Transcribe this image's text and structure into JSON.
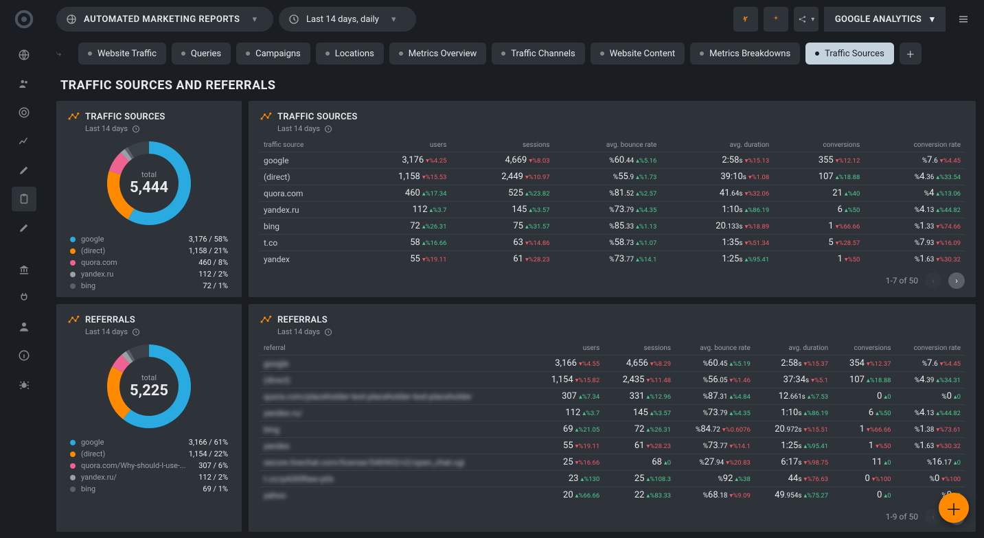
{
  "header": {
    "report_name": "AUTOMATED MARKETING REPORTS",
    "date_range": "Last 14 days, daily",
    "profile": "GOOGLE ANALYTICS"
  },
  "tabs": [
    {
      "label": "Website Traffic",
      "active": false
    },
    {
      "label": "Queries",
      "active": false
    },
    {
      "label": "Campaigns",
      "active": false
    },
    {
      "label": "Locations",
      "active": false
    },
    {
      "label": "Metrics Overview",
      "active": false
    },
    {
      "label": "Traffic Channels",
      "active": false
    },
    {
      "label": "Website Content",
      "active": false
    },
    {
      "label": "Metrics Breakdowns",
      "active": false
    },
    {
      "label": "Traffic Sources",
      "active": true
    }
  ],
  "page_title": "TRAFFIC SOURCES AND REFERRALS",
  "subtitle": "Last 14 days",
  "colors": [
    "#29abe2",
    "#ff8a00",
    "#f06292",
    "#9aa0a6",
    "#5a6068",
    "#4ec88a",
    "#ffd54f"
  ],
  "chart_data": [
    {
      "id": "traffic_sources_donut",
      "type": "pie",
      "title": "TRAFFIC SOURCES",
      "total_label": "total",
      "total": "5,444",
      "categories": [
        "google",
        "(direct)",
        "quora.com",
        "yandex.ru",
        "bing"
      ],
      "values": [
        3176,
        1158,
        460,
        112,
        72
      ],
      "pct": [
        58,
        21,
        8,
        2,
        1
      ],
      "display_values": [
        "3,176",
        "1,158",
        "460",
        "112",
        "72"
      ]
    },
    {
      "id": "referrals_donut",
      "type": "pie",
      "title": "REFERRALS",
      "total_label": "total",
      "total": "5,225",
      "categories": [
        "google",
        "(direct)",
        "quora.com/Why-should-I-use-...",
        "yandex.ru/",
        "bing"
      ],
      "values": [
        3166,
        1154,
        307,
        112,
        69
      ],
      "pct": [
        61,
        22,
        6,
        2,
        1
      ],
      "display_values": [
        "3,166",
        "1,154",
        "307",
        "112",
        "69"
      ]
    }
  ],
  "tables": {
    "traffic": {
      "title": "TRAFFIC SOURCES",
      "head_label": "traffic source",
      "columns": [
        "users",
        "sessions",
        "avg. bounce rate",
        "avg. duration",
        "conversions",
        "conversion rate"
      ],
      "pager": "1-7 of 50",
      "rows": [
        {
          "src": "google",
          "cells": [
            {
              "v": "3,176",
              "d": "%4.25",
              "dir": "down"
            },
            {
              "v": "4,669",
              "d": "%8.03",
              "dir": "down"
            },
            {
              "v": "60",
              "suf": ".44",
              "pre": "%",
              "d": "%5.16",
              "dir": "up"
            },
            {
              "v": "2:58",
              "suf": "s",
              "d": "%15.13",
              "dir": "down"
            },
            {
              "v": "355",
              "d": "%12.12",
              "dir": "down"
            },
            {
              "v": "7",
              "suf": ".6",
              "pre": "%",
              "d": "%4.45",
              "dir": "down"
            }
          ]
        },
        {
          "src": "(direct)",
          "cells": [
            {
              "v": "1,158",
              "d": "%15.53",
              "dir": "down"
            },
            {
              "v": "2,449",
              "d": "%10.97",
              "dir": "down"
            },
            {
              "v": "55",
              "suf": ".9",
              "pre": "%",
              "d": "%1.73",
              "dir": "up"
            },
            {
              "v": "39:10",
              "suf": "s",
              "d": "%1.08",
              "dir": "down"
            },
            {
              "v": "107",
              "d": "%18.88",
              "dir": "up"
            },
            {
              "v": "4",
              "suf": ".36",
              "pre": "%",
              "d": "%33.54",
              "dir": "up"
            }
          ]
        },
        {
          "src": "quora.com",
          "cells": [
            {
              "v": "460",
              "d": "%17.34",
              "dir": "up"
            },
            {
              "v": "525",
              "d": "%23.82",
              "dir": "up"
            },
            {
              "v": "81",
              "suf": ".52",
              "pre": "%",
              "d": "%2.57",
              "dir": "up"
            },
            {
              "v": "41",
              "suf": ".64s",
              "d": "%32.06",
              "dir": "down"
            },
            {
              "v": "21",
              "d": "%40",
              "dir": "up"
            },
            {
              "v": "4",
              "pre": "%",
              "d": "%13.06",
              "dir": "up"
            }
          ]
        },
        {
          "src": "yandex.ru",
          "cells": [
            {
              "v": "112",
              "d": "%3.7",
              "dir": "up"
            },
            {
              "v": "145",
              "d": "%3.57",
              "dir": "up"
            },
            {
              "v": "73",
              "suf": ".79",
              "pre": "%",
              "d": "%4.35",
              "dir": "up"
            },
            {
              "v": "1:10",
              "suf": "s",
              "d": "%86.19",
              "dir": "up"
            },
            {
              "v": "6",
              "d": "%50",
              "dir": "up"
            },
            {
              "v": "4",
              "suf": ".13",
              "pre": "%",
              "d": "%44.82",
              "dir": "up"
            }
          ]
        },
        {
          "src": "bing",
          "cells": [
            {
              "v": "72",
              "d": "%26.31",
              "dir": "up"
            },
            {
              "v": "75",
              "d": "%31.57",
              "dir": "up"
            },
            {
              "v": "85",
              "suf": ".33",
              "pre": "%",
              "d": "%1.13",
              "dir": "up"
            },
            {
              "v": "20",
              "suf": ".133s",
              "d": "%18.89",
              "dir": "down"
            },
            {
              "v": "1",
              "d": "%66.66",
              "dir": "down"
            },
            {
              "v": "1",
              "suf": ".33",
              "pre": "%",
              "d": "%74.66",
              "dir": "down"
            }
          ]
        },
        {
          "src": "t.co",
          "cells": [
            {
              "v": "58",
              "d": "%16.66",
              "dir": "up"
            },
            {
              "v": "63",
              "d": "%14.86",
              "dir": "down"
            },
            {
              "v": "58",
              "suf": ".73",
              "pre": "%",
              "d": "%1.07",
              "dir": "up"
            },
            {
              "v": "1:35",
              "suf": "s",
              "d": "%51.34",
              "dir": "down"
            },
            {
              "v": "5",
              "d": "%28.57",
              "dir": "down"
            },
            {
              "v": "7",
              "suf": ".93",
              "pre": "%",
              "d": "%16.09",
              "dir": "down"
            }
          ]
        },
        {
          "src": "yandex",
          "cells": [
            {
              "v": "55",
              "d": "%19.11",
              "dir": "down"
            },
            {
              "v": "61",
              "d": "%28.23",
              "dir": "down"
            },
            {
              "v": "73",
              "suf": ".77",
              "pre": "%",
              "d": "%14.1",
              "dir": "up"
            },
            {
              "v": "1:25",
              "suf": "s",
              "d": "%95.41",
              "dir": "up"
            },
            {
              "v": "1",
              "d": "%50",
              "dir": "down"
            },
            {
              "v": "1",
              "suf": ".63",
              "pre": "%",
              "d": "%30.32",
              "dir": "down"
            }
          ]
        }
      ]
    },
    "referrals": {
      "title": "REFERRALS",
      "head_label": "referral",
      "columns": [
        "users",
        "sessions",
        "avg. bounce rate",
        "avg. duration",
        "conversions",
        "conversion rate"
      ],
      "pager": "1-9 of 50",
      "rows": [
        {
          "src": "google",
          "blur": true,
          "cells": [
            {
              "v": "3,166",
              "d": "%4.55",
              "dir": "down"
            },
            {
              "v": "4,656",
              "d": "%8.29",
              "dir": "down"
            },
            {
              "v": "60",
              "suf": ".45",
              "pre": "%",
              "d": "%5.19",
              "dir": "up"
            },
            {
              "v": "2:58",
              "suf": "s",
              "d": "%15.37",
              "dir": "down"
            },
            {
              "v": "354",
              "d": "%12.37",
              "dir": "down"
            },
            {
              "v": "7",
              "suf": ".6",
              "pre": "%",
              "d": "%4.45",
              "dir": "down"
            }
          ]
        },
        {
          "src": "(direct)",
          "blur": true,
          "cells": [
            {
              "v": "1,154",
              "d": "%15.82",
              "dir": "down"
            },
            {
              "v": "2,435",
              "d": "%11.48",
              "dir": "down"
            },
            {
              "v": "56",
              "suf": ".05",
              "pre": "%",
              "d": "%1.46",
              "dir": "down"
            },
            {
              "v": "37:34",
              "suf": "s",
              "d": "%5.1",
              "dir": "down"
            },
            {
              "v": "107",
              "d": "%18.88",
              "dir": "up"
            },
            {
              "v": "4",
              "suf": ".39",
              "pre": "%",
              "d": "%34.31",
              "dir": "up"
            }
          ]
        },
        {
          "src": "quora.com/placeholder-text-placeholder-text-placeholder",
          "blur": true,
          "cells": [
            {
              "v": "307",
              "d": "%7.34",
              "dir": "up"
            },
            {
              "v": "331",
              "d": "%12.96",
              "dir": "up"
            },
            {
              "v": "87",
              "suf": ".31",
              "pre": "%",
              "d": "%4.84",
              "dir": "up"
            },
            {
              "v": "12",
              "suf": ".661s",
              "d": "%7.53",
              "dir": "up"
            },
            {
              "v": "0",
              "d": "0",
              "dir": "up"
            },
            {
              "v": "0",
              "pre": "%",
              "d": "0",
              "dir": "up"
            }
          ]
        },
        {
          "src": "yandex.ru/",
          "blur": true,
          "cells": [
            {
              "v": "112",
              "d": "%3.7",
              "dir": "up"
            },
            {
              "v": "145",
              "d": "%3.57",
              "dir": "up"
            },
            {
              "v": "73",
              "suf": ".79",
              "pre": "%",
              "d": "%4.35",
              "dir": "up"
            },
            {
              "v": "1:10",
              "suf": "s",
              "d": "%86.19",
              "dir": "up"
            },
            {
              "v": "6",
              "d": "%50",
              "dir": "up"
            },
            {
              "v": "4",
              "suf": ".13",
              "pre": "%",
              "d": "%44.82",
              "dir": "up"
            }
          ]
        },
        {
          "src": "bing",
          "blur": true,
          "cells": [
            {
              "v": "69",
              "d": "%21.05",
              "dir": "up"
            },
            {
              "v": "72",
              "d": "%26.31",
              "dir": "up"
            },
            {
              "v": "84",
              "suf": ".72",
              "pre": "%",
              "d": "%0.6076",
              "dir": "down"
            },
            {
              "v": "20",
              "suf": ".972s",
              "d": "%15.51",
              "dir": "down"
            },
            {
              "v": "1",
              "d": "%66.66",
              "dir": "down"
            },
            {
              "v": "1",
              "suf": ".38",
              "pre": "%",
              "d": "%73.61",
              "dir": "down"
            }
          ]
        },
        {
          "src": "yandex",
          "blur": true,
          "cells": [
            {
              "v": "55",
              "d": "%19.11",
              "dir": "down"
            },
            {
              "v": "61",
              "d": "%28.23",
              "dir": "down"
            },
            {
              "v": "73",
              "suf": ".77",
              "pre": "%",
              "d": "%14.1",
              "dir": "down"
            },
            {
              "v": "1:25",
              "suf": "s",
              "d": "%95.41",
              "dir": "up"
            },
            {
              "v": "1",
              "d": "%50",
              "dir": "down"
            },
            {
              "v": "1",
              "suf": ".63",
              "pre": "%",
              "d": "%30.32",
              "dir": "down"
            }
          ]
        },
        {
          "src": "secure.livechat.com/license/S46903/v2/open_chat.cgi",
          "blur": true,
          "cells": [
            {
              "v": "25",
              "d": "%16.66",
              "dir": "down"
            },
            {
              "v": "68",
              "d": "0",
              "dir": "up"
            },
            {
              "v": "27",
              "suf": ".94",
              "pre": "%",
              "d": "%20.83",
              "dir": "down"
            },
            {
              "v": "6:17",
              "suf": "s",
              "d": "%98.75",
              "dir": "down"
            },
            {
              "v": "11",
              "d": "0",
              "dir": "up"
            },
            {
              "v": "16",
              "suf": ".17",
              "pre": "%",
              "d": "0",
              "dir": "up"
            }
          ]
        },
        {
          "src": "t.co/pA0I0Raw-p0x",
          "blur": true,
          "cells": [
            {
              "v": "23",
              "d": "%130",
              "dir": "up"
            },
            {
              "v": "25",
              "d": "%108.3",
              "dir": "up"
            },
            {
              "v": "92",
              "pre": "%",
              "d": "%38",
              "dir": "up"
            },
            {
              "v": "44",
              "suf": "s",
              "d": "%76.63",
              "dir": "down"
            },
            {
              "v": "0",
              "d": "%100",
              "dir": "down"
            },
            {
              "v": "0",
              "pre": "%",
              "d": "%100",
              "dir": "down"
            }
          ]
        },
        {
          "src": "yahoo",
          "blur": true,
          "cells": [
            {
              "v": "20",
              "d": "%66.66",
              "dir": "up"
            },
            {
              "v": "22",
              "d": "%83.33",
              "dir": "up"
            },
            {
              "v": "68",
              "suf": ".18",
              "pre": "%",
              "d": "%9.09",
              "dir": "down"
            },
            {
              "v": "49",
              "suf": ".954s",
              "d": "%75.27",
              "dir": "up"
            },
            {
              "v": "0",
              "d": "0",
              "dir": "up"
            },
            {
              "v": "0",
              "pre": "%",
              "d": "0",
              "dir": "up"
            }
          ]
        }
      ]
    }
  }
}
